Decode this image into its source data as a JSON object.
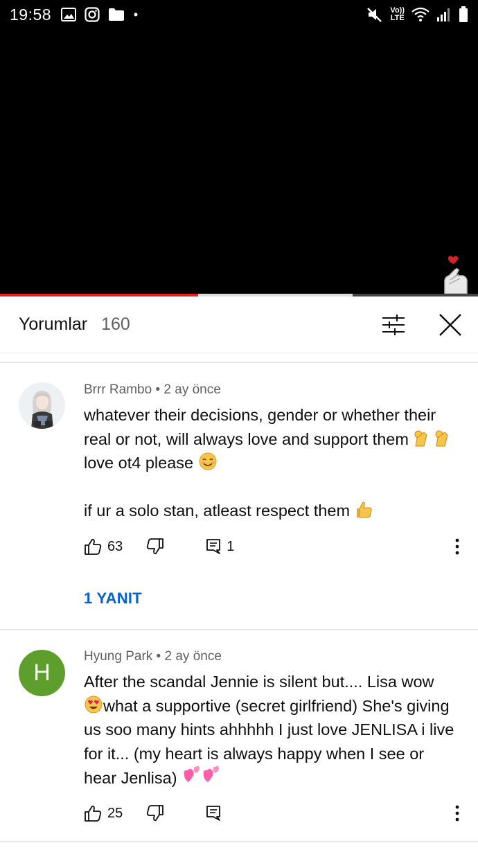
{
  "status_bar": {
    "time": "19:58",
    "left_icons": [
      "image-icon",
      "instagram-icon",
      "folder-icon",
      "dot-icon"
    ],
    "right_icons": [
      "mute-icon",
      "volte-icon",
      "wifi-icon",
      "signal-icon",
      "battery-icon"
    ],
    "network_top": "Vo))",
    "network_bottom": "LTE"
  },
  "player": {
    "progress_fraction": 0.415,
    "buffer_fraction": 0.738,
    "accent": "#e62117"
  },
  "comments_panel": {
    "title": "Yorumlar",
    "count": "160",
    "filter_icon": "sliders-icon",
    "close_icon": "close-icon"
  },
  "comments": [
    {
      "author": "Brrr Rambo",
      "age": "2 ay önce",
      "lines": [
        "whatever their decisions, gender or whether their",
        "real or not, will always love and support them",
        "love ot4 please",
        "",
        "if ur a solo stan, atleast respect them"
      ],
      "likes": "63",
      "replies_count": "1",
      "reply_link": "1 YANIT"
    },
    {
      "author": "Hyung Park",
      "age": "2 ay önce",
      "avatar_letter": "H",
      "avatar_color": "#5d9e2d",
      "lines": [
        "After the scandal Jennie is silent but.... Lisa wow",
        "what a supportive (secret girlfriend) She's giving",
        "us soo many hints ahhhhh I just love JENLISA i live",
        "for it... (my heart is always happy when I see or",
        "hear Jenlisa)"
      ],
      "likes": "25"
    }
  ]
}
